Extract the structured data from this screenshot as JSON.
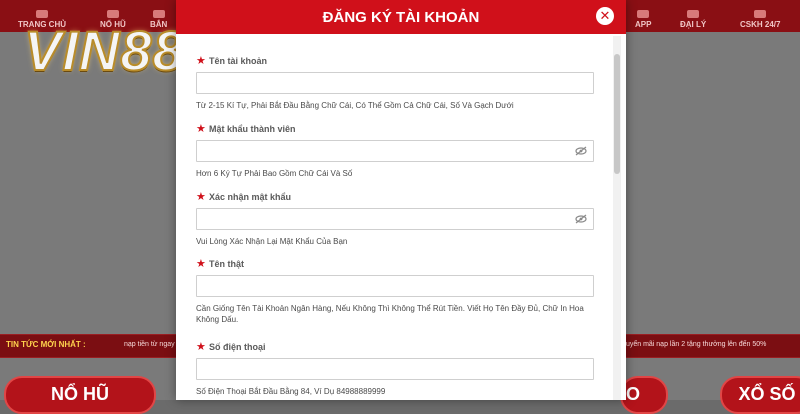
{
  "background": {
    "nav_items": [
      {
        "label": "TRANG CHỦ"
      },
      {
        "label": "NỔ HŨ"
      },
      {
        "label": "BẮN"
      },
      {
        "label": "APP"
      },
      {
        "label": "ĐẠI LÝ"
      },
      {
        "label": "CSKH 24/7"
      }
    ],
    "logo_text": "VIN88",
    "news": {
      "label": "TIN TỨC MỚI NHẤT :",
      "left_text": "nạp tiền từ ngay",
      "right_text": "tuyển mãi nạp lần 2 tặng thưởng lên đến 50%"
    },
    "games": {
      "left": "NỔ HŨ",
      "mid": "O",
      "right": "XỔ SỐ"
    }
  },
  "modal": {
    "title": "ĐĂNG KÝ TÀI KHOẢN",
    "close_glyph": "✕",
    "fields": {
      "username": {
        "label": "Tên tài khoản",
        "value": "",
        "hint": "Từ 2-15 Kí Tự, Phải Bắt Đầu Bằng Chữ Cái, Có Thể Gồm Cả Chữ Cái, Số Và Gạch Dưới"
      },
      "password": {
        "label": "Mật khẩu thành viên",
        "value": "",
        "hint": "Hơn 6 Ký Tự Phải Bao Gồm Chữ Cái Và Số"
      },
      "confirm": {
        "label": "Xác nhận mật khẩu",
        "value": "",
        "hint": "Vui Lòng Xác Nhận Lại Mật Khẩu Của Bạn"
      },
      "fullname": {
        "label": "Tên thật",
        "value": "",
        "hint": "Cần Giống Tên Tài Khoản Ngân Hàng, Nếu Không Thì Không Thể Rút Tiền. Viết Họ Tên Đầy Đủ, Chữ In Hoa Không Dấu."
      },
      "phone": {
        "label": "Số điện thoại",
        "value": "",
        "hint": "Số Điện Thoại Bắt Đầu Bằng 84, Ví Dụ 84988889999"
      }
    }
  },
  "icons": {
    "required": "star-icon",
    "eye": "eye-slash-icon"
  },
  "colors": {
    "brand_red": "#d0101a",
    "nav_red": "#8a0f14",
    "gold": "#ffd34d"
  }
}
